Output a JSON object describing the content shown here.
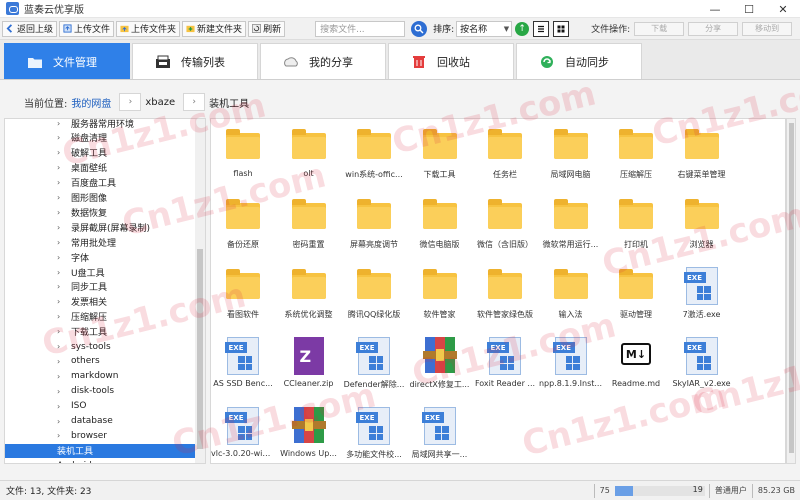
{
  "window": {
    "title": "蓝奏云优享版",
    "controls": [
      "—",
      "☐",
      "✕"
    ]
  },
  "toolbar": {
    "buttons": [
      {
        "label": "返回上级",
        "icon": "back-icon"
      },
      {
        "label": "上传文件",
        "icon": "upload-file-icon"
      },
      {
        "label": "上传文件夹",
        "icon": "upload-folder-icon"
      },
      {
        "label": "新建文件夹",
        "icon": "new-folder-icon"
      },
      {
        "label": "刷新",
        "icon": "refresh-icon"
      }
    ],
    "search_placeholder": "搜索文件...",
    "sort_label": "排序:",
    "sort_value": "按名称",
    "file_ops_label": "文件操作:",
    "file_ops": [
      "下载",
      "分享",
      "移动到"
    ]
  },
  "tabs": [
    {
      "label": "文件管理",
      "icon": "folder-icon",
      "active": true
    },
    {
      "label": "传输列表",
      "icon": "transfer-icon",
      "active": false
    },
    {
      "label": "我的分享",
      "icon": "share-icon",
      "active": false
    },
    {
      "label": "回收站",
      "icon": "trash-icon",
      "active": false
    },
    {
      "label": "自动同步",
      "icon": "sync-icon",
      "active": false
    }
  ],
  "breadcrumb": {
    "label": "当前位置:",
    "items": [
      "我的网盘",
      "xbaze",
      "装机工具"
    ],
    "separator": "›"
  },
  "tree": {
    "items": [
      {
        "label": "服务器常用环境"
      },
      {
        "label": "磁盘清理"
      },
      {
        "label": "破解工具"
      },
      {
        "label": "桌面壁纸"
      },
      {
        "label": "百度盘工具"
      },
      {
        "label": "图形图像"
      },
      {
        "label": "数据恢复"
      },
      {
        "label": "录屏截屏(屏幕录制)"
      },
      {
        "label": "常用批处理"
      },
      {
        "label": "字体"
      },
      {
        "label": "U盘工具"
      },
      {
        "label": "同步工具"
      },
      {
        "label": "发票相关"
      },
      {
        "label": "压缩解压"
      },
      {
        "label": "下载工具"
      },
      {
        "label": "sys-tools"
      },
      {
        "label": "others"
      },
      {
        "label": "markdown"
      },
      {
        "label": "disk-tools"
      },
      {
        "label": "ISO"
      },
      {
        "label": "database"
      },
      {
        "label": "browser"
      },
      {
        "label": "装机工具",
        "selected": true
      },
      {
        "label": "Android"
      }
    ]
  },
  "files": [
    {
      "name": "flash",
      "type": "folder"
    },
    {
      "name": "olt",
      "type": "folder"
    },
    {
      "name": "win系统-offic...",
      "type": "folder"
    },
    {
      "name": "下载工具",
      "type": "folder"
    },
    {
      "name": "任务栏",
      "type": "folder"
    },
    {
      "name": "局域网电脑",
      "type": "folder"
    },
    {
      "name": "压缩解压",
      "type": "folder"
    },
    {
      "name": "右键菜单管理",
      "type": "folder"
    },
    {
      "name": "备份还原",
      "type": "folder"
    },
    {
      "name": "密码重置",
      "type": "folder"
    },
    {
      "name": "屏幕亮度调节",
      "type": "folder"
    },
    {
      "name": "微信电脑版",
      "type": "folder"
    },
    {
      "name": "微信（含旧版）",
      "type": "folder"
    },
    {
      "name": "微软常用运行...",
      "type": "folder"
    },
    {
      "name": "打印机",
      "type": "folder"
    },
    {
      "name": "浏览器",
      "type": "folder"
    },
    {
      "name": "看图软件",
      "type": "folder"
    },
    {
      "name": "系统优化调整",
      "type": "folder"
    },
    {
      "name": "腾讯QQ绿化版",
      "type": "folder"
    },
    {
      "name": "软件管家",
      "type": "folder"
    },
    {
      "name": "软件管家绿色版",
      "type": "folder"
    },
    {
      "name": "输入法",
      "type": "folder"
    },
    {
      "name": "驱动管理",
      "type": "folder"
    },
    {
      "name": "7激活.exe",
      "type": "exe"
    },
    {
      "name": "AS SSD Benc...",
      "type": "exe"
    },
    {
      "name": "CCleaner.zip",
      "type": "zip"
    },
    {
      "name": "Defender解除...",
      "type": "exe"
    },
    {
      "name": "directX修复工...",
      "type": "rar"
    },
    {
      "name": "Foxit Reader ...",
      "type": "exe"
    },
    {
      "name": "npp.8.1.9.Inst...",
      "type": "exe"
    },
    {
      "name": "Readme.md",
      "type": "md"
    },
    {
      "name": "SkyIAR_v2.exe",
      "type": "exe"
    },
    {
      "name": "vlc-3.0.20-win...",
      "type": "exe"
    },
    {
      "name": "Windows Up...",
      "type": "rar"
    },
    {
      "name": "多功能文件校...",
      "type": "exe"
    },
    {
      "name": "局域网共享一...",
      "type": "exe"
    }
  ],
  "status": {
    "left": "文件: 13, 文件夹: 23",
    "progress_text": "19",
    "progress_fraction": 0.2,
    "page_text": "75",
    "user_type": "普通用户",
    "storage": "85.23 GB"
  },
  "watermark": "Cn1z1.com",
  "colors": {
    "accent": "#2f80e8",
    "folder": "#f7c341",
    "exe": "#3d7fd8",
    "watermark": "#dc283c"
  }
}
